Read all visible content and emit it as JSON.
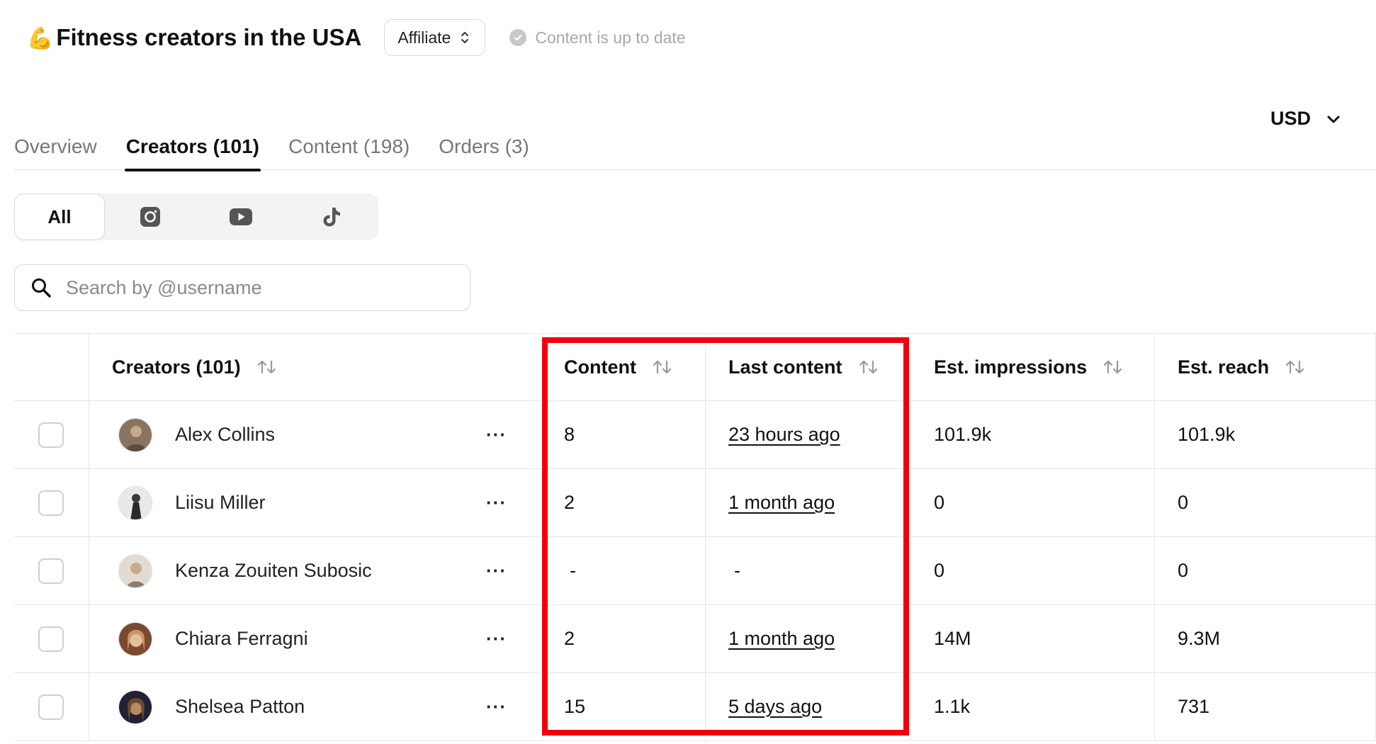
{
  "header": {
    "emoji": "💪",
    "title": "Fitness creators in the USA",
    "type_select_value": "Affiliate",
    "status_text": "Content is up to date"
  },
  "currency": {
    "value": "USD"
  },
  "tabs": [
    {
      "label": "Overview",
      "active": false
    },
    {
      "label": "Creators (101)",
      "active": true
    },
    {
      "label": "Content (198)",
      "active": false
    },
    {
      "label": "Orders (3)",
      "active": false
    }
  ],
  "platform_filter": {
    "all_label": "All",
    "icons": [
      "instagram-icon",
      "youtube-icon",
      "tiktok-icon"
    ]
  },
  "search": {
    "placeholder": "Search by @username",
    "value": ""
  },
  "table": {
    "columns": {
      "creators": "Creators (101)",
      "content": "Content",
      "last_content": "Last content",
      "impressions": "Est. impressions",
      "reach": "Est. reach"
    },
    "rows": [
      {
        "name": "Alex Collins",
        "content": "8",
        "last_content": "23 hours ago",
        "impressions": "101.9k",
        "reach": "101.9k",
        "avatar_color": "#8a7460"
      },
      {
        "name": "Liisu Miller",
        "content": "2",
        "last_content": "1 month ago",
        "impressions": "0",
        "reach": "0",
        "avatar_color": "#5a5a5a"
      },
      {
        "name": "Kenza Zouiten Subosic",
        "content": "-",
        "last_content": "-",
        "impressions": "0",
        "reach": "0",
        "avatar_color": "#c9b8a8"
      },
      {
        "name": "Chiara Ferragni",
        "content": "2",
        "last_content": "1 month ago",
        "impressions": "14M",
        "reach": "9.3M",
        "avatar_color": "#b07a55"
      },
      {
        "name": "Shelsea Patton",
        "content": "15",
        "last_content": "5 days ago",
        "impressions": "1.1k",
        "reach": "731",
        "avatar_color": "#9c6a4a"
      }
    ]
  },
  "highlight_color": "#f0000d"
}
